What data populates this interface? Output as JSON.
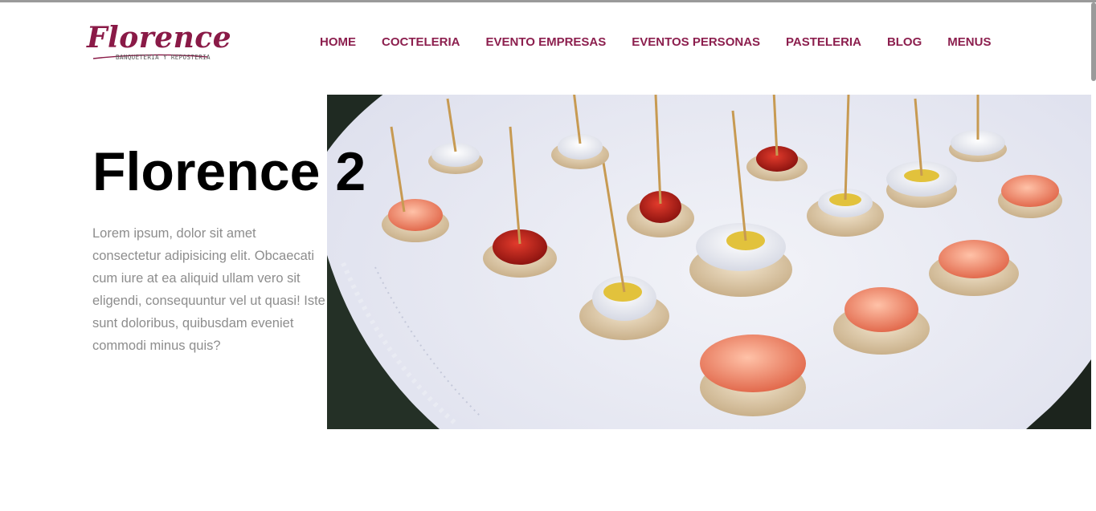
{
  "brand": {
    "name": "Florence",
    "tagline": "BANQUETERIA Y REPOSTERIA",
    "color": "#8a1a47"
  },
  "nav": {
    "items": [
      {
        "label": "HOME"
      },
      {
        "label": "COCTELERIA"
      },
      {
        "label": "EVENTO EMPRESAS"
      },
      {
        "label": "EVENTOS PERSONAS"
      },
      {
        "label": "PASTELERIA"
      },
      {
        "label": "BLOG"
      },
      {
        "label": "MENUS"
      }
    ],
    "color": "#8c1f4e"
  },
  "hero": {
    "title": "Florence 2",
    "text": "Lorem ipsum, dolor sit amet consectetur adipisicing elit. Obcaecati cum iure at ea aliquid ullam vero sit eligendi, consequuntur vel ut quasi! Iste sunt doloribus, quibusdam eveniet commodi minus quis?"
  }
}
